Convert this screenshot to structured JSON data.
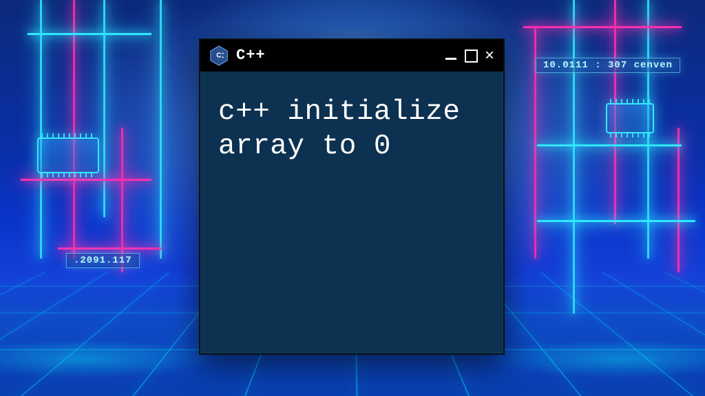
{
  "window": {
    "title": "C++",
    "body_text": "c++ initialize array to 0"
  },
  "bg_labels": {
    "left_code": ".2091.117",
    "right_code": "10.0111 : 307  cenven"
  }
}
